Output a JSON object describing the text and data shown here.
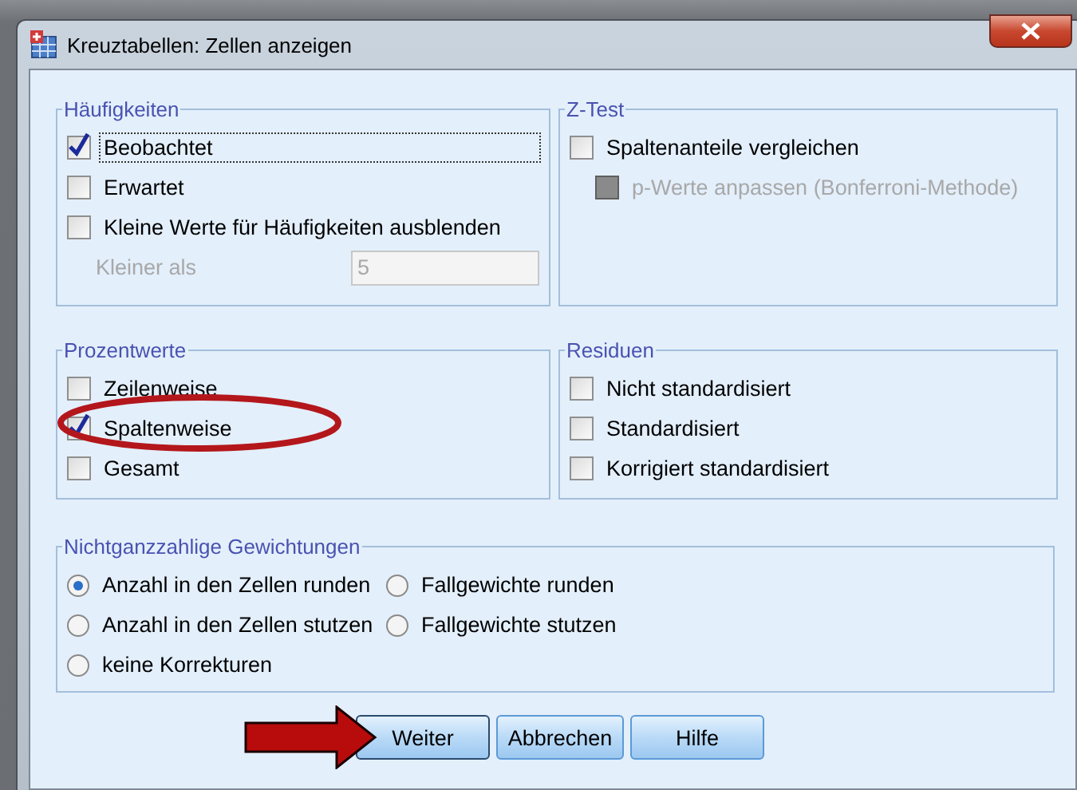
{
  "window": {
    "title": "Kreuztabellen: Zellen anzeigen"
  },
  "groups": [
    {
      "title": "Häufigkeiten",
      "items": [
        {
          "kind": "checkbox",
          "label": "Beobachtet",
          "checked": true,
          "disabled": false,
          "focused": true
        },
        {
          "kind": "checkbox",
          "label": "Erwartet",
          "checked": false,
          "disabled": false,
          "focused": false
        },
        {
          "kind": "checkbox",
          "label": "Kleine Werte für Häufigkeiten ausblenden",
          "checked": false,
          "disabled": false,
          "focused": false
        },
        {
          "kind": "number",
          "label": "Kleiner als",
          "value": "5",
          "disabled": true
        }
      ]
    },
    {
      "title": "Z-Test",
      "items": [
        {
          "kind": "checkbox",
          "label": "Spaltenanteile vergleichen",
          "checked": false,
          "disabled": false,
          "focused": false
        },
        {
          "kind": "subcheckbox",
          "label": "p-Werte anpassen (Bonferroni-Methode)",
          "checked": false,
          "disabled": true,
          "focused": false
        }
      ]
    },
    {
      "title": "Prozentwerte",
      "items": [
        {
          "kind": "checkbox",
          "label": "Zeilenweise",
          "checked": false,
          "disabled": false,
          "focused": false
        },
        {
          "kind": "checkbox",
          "label": "Spaltenweise",
          "checked": true,
          "disabled": false,
          "focused": false,
          "circled": true
        },
        {
          "kind": "checkbox",
          "label": "Gesamt",
          "checked": false,
          "disabled": false,
          "focused": false
        }
      ]
    },
    {
      "title": "Residuen",
      "items": [
        {
          "kind": "checkbox",
          "label": "Nicht standardisiert",
          "checked": false,
          "disabled": false,
          "focused": false
        },
        {
          "kind": "checkbox",
          "label": "Standardisiert",
          "checked": false,
          "disabled": false,
          "focused": false
        },
        {
          "kind": "checkbox",
          "label": "Korrigiert standardisiert",
          "checked": false,
          "disabled": false,
          "focused": false
        }
      ]
    }
  ],
  "weights": {
    "title": "Nichtganzzahlige Gewichtungen",
    "options": [
      {
        "label": "Anzahl in den Zellen runden",
        "selected": true
      },
      {
        "label": "Fallgewichte runden",
        "selected": false
      },
      {
        "label": "Anzahl in den Zellen stutzen",
        "selected": false
      },
      {
        "label": "Fallgewichte stutzen",
        "selected": false
      },
      {
        "label": "keine Korrekturen",
        "selected": false
      }
    ]
  },
  "buttons": [
    {
      "label": "Weiter",
      "arrow": true
    },
    {
      "label": "Abbrechen",
      "arrow": false
    },
    {
      "label": "Hilfe",
      "arrow": false
    }
  ]
}
